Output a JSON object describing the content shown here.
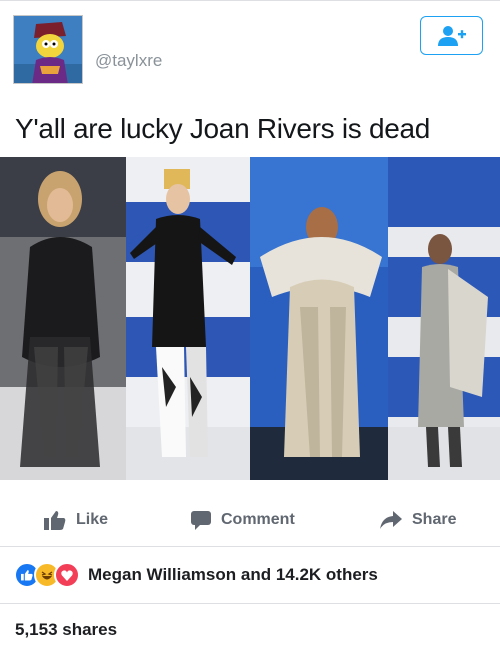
{
  "tweet": {
    "handle": "@taylxre",
    "text": "Y'all are lucky Joan Rivers is dead"
  },
  "actions": {
    "like": "Like",
    "comment": "Comment",
    "share": "Share"
  },
  "reactions": {
    "summary": "Megan Williamson and 14.2K others",
    "types": [
      "like-icon",
      "haha-icon",
      "love-icon"
    ]
  },
  "shares": "5,153 shares",
  "colors": {
    "twitter_blue": "#1da1f2",
    "fb_blue": "#1877f2",
    "gray_text": "#606770",
    "haha_yellow": "#f7b928",
    "love_red": "#f33e58"
  }
}
